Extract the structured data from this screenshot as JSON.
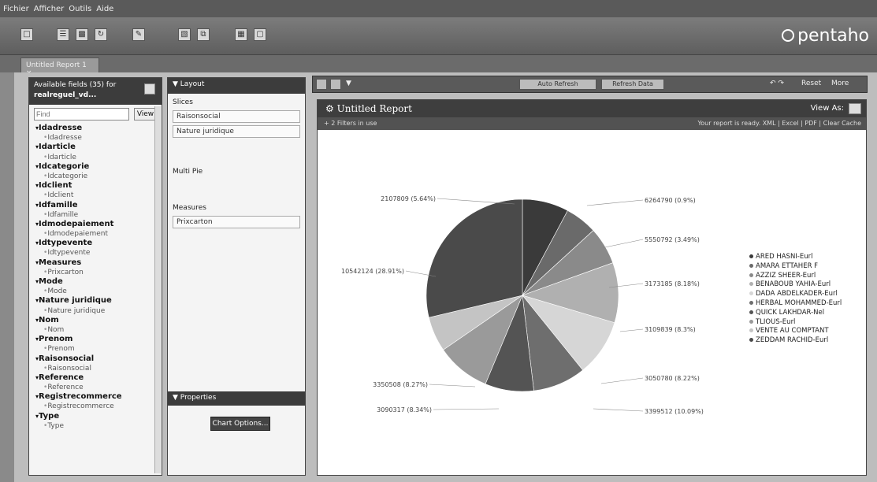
{
  "menu": [
    "Fichier",
    "Afficher",
    "Outils",
    "Aide"
  ],
  "toolbar": {
    "brand": "pentaho"
  },
  "tabs": [
    {
      "label": "Untitled Report 1"
    }
  ],
  "fields_panel": {
    "title": "Available fields (35) for",
    "subtitle": "realreguel_vd...",
    "find_placeholder": "Find",
    "view_label": "View",
    "groups": [
      {
        "name": "Idadresse",
        "item": "Idadresse"
      },
      {
        "name": "Idarticle",
        "item": "Idarticle"
      },
      {
        "name": "Idcategorie",
        "item": "Idcategorie"
      },
      {
        "name": "Idclient",
        "item": "Idclient"
      },
      {
        "name": "Idfamille",
        "item": "Idfamille"
      },
      {
        "name": "Idmodepaiement",
        "item": "Idmodepaiement"
      },
      {
        "name": "Idtypevente",
        "item": "Idtypevente"
      },
      {
        "name": "Measures",
        "item": "Prixcarton"
      },
      {
        "name": "Mode",
        "item": "Mode"
      },
      {
        "name": "Nature juridique",
        "item": "Nature juridique"
      },
      {
        "name": "Nom",
        "item": "Nom"
      },
      {
        "name": "Prenom",
        "item": "Prenom"
      },
      {
        "name": "Raisonsocial",
        "item": "Raisonsocial"
      },
      {
        "name": "Reference",
        "item": "Reference"
      },
      {
        "name": "Registrecommerce",
        "item": "Registrecommerce"
      },
      {
        "name": "Type",
        "item": "Type"
      }
    ]
  },
  "layout_panel": {
    "title": "Layout",
    "slices_label": "Slices",
    "slices": [
      "Raisonsocial",
      "Nature juridique"
    ],
    "multi_pie_label": "Multi Pie",
    "measures_label": "Measures",
    "measures": [
      "Prixcarton"
    ],
    "properties_label": "Properties",
    "chart_options_label": "Chart Options..."
  },
  "report_bar": {
    "btn1": "Auto Refresh",
    "btn2": "Refresh Data",
    "reset": "Reset",
    "more": "More"
  },
  "report": {
    "title": "Untitled Report",
    "view_as": "View As:",
    "filters": "2 Filters in use",
    "status": "Your report is ready.",
    "links": "XML | Excel | PDF | Clear Cache"
  },
  "chart_data": {
    "type": "pie",
    "slices": [
      {
        "label": "ARED HASNI-Eurl",
        "value": 7.8,
        "color": "#3a3a3a"
      },
      {
        "label": "AMARA ETTAHER F",
        "value": 5.4,
        "color": "#6a6a6a"
      },
      {
        "label": "AZZIZ SHEER-Eurl",
        "value": 6.3,
        "color": "#8a8a8a"
      },
      {
        "label": "BENABOUB YAHIA-Eurl",
        "value": 10.1,
        "color": "#b0b0b0"
      },
      {
        "label": "DADA ABDELKADER-Eurl",
        "value": 9.6,
        "color": "#d6d6d6"
      },
      {
        "label": "HERBAL MOHAMMED-Eurl",
        "value": 8.9,
        "color": "#6e6e6e"
      },
      {
        "label": "QUICK LAKHDAR-Nel",
        "value": 8.2,
        "color": "#545454"
      },
      {
        "label": "TLIOUS-Eurl",
        "value": 9.1,
        "color": "#9a9a9a"
      },
      {
        "label": "VENTE AU COMPTANT",
        "value": 5.9,
        "color": "#c4c4c4"
      },
      {
        "label": "ZEDDAM RACHID-Eurl",
        "value": 28.7,
        "color": "#4a4a4a"
      }
    ],
    "data_labels": [
      {
        "text": "2107809 (5.64%)"
      },
      {
        "text": "6264790 (0.9%)"
      },
      {
        "text": "5550792 (3.49%)"
      },
      {
        "text": "10542124 (28.91%)"
      },
      {
        "text": "3173185 (8.18%)"
      },
      {
        "text": "3109839 (8.3%)"
      },
      {
        "text": "3050780 (8.22%)"
      },
      {
        "text": "3350508 (8.27%)"
      },
      {
        "text": "3090317 (8.34%)"
      },
      {
        "text": "3399512 (10.09%)"
      }
    ]
  }
}
